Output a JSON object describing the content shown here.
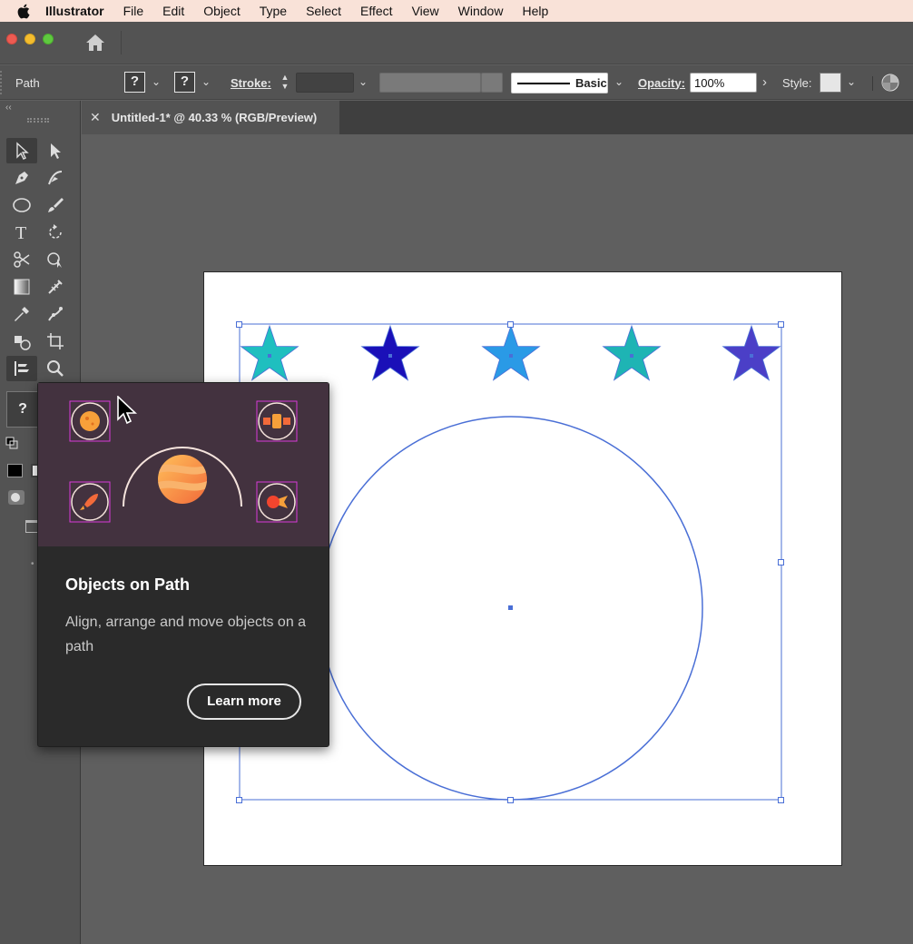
{
  "menubar": {
    "app_name": "Illustrator",
    "items": [
      "File",
      "Edit",
      "Object",
      "Type",
      "Select",
      "Effect",
      "View",
      "Window",
      "Help"
    ]
  },
  "control_bar": {
    "selection_label": "Path",
    "fill_placeholder": "?",
    "stroke_placeholder": "?",
    "stroke_label": "Stroke:",
    "brush_label": "Basic",
    "opacity_label": "Opacity:",
    "opacity_value": "100%",
    "style_label": "Style:"
  },
  "document_tab": {
    "title": "Untitled-1* @ 40.33 % (RGB/Preview)"
  },
  "tools_panel": {
    "fill_stroke_placeholder": "?"
  },
  "artboard": {
    "stars": [
      {
        "color": "#1fbfbf"
      },
      {
        "color": "#1a10b8"
      },
      {
        "color": "#2a9ae6"
      },
      {
        "color": "#1eb4b4"
      },
      {
        "color": "#4b3fc7"
      }
    ],
    "selection_color": "#4a6fd6"
  },
  "tooltip": {
    "title": "Objects on Path",
    "description": "Align, arrange and move objects on a path",
    "button_label": "Learn more"
  }
}
